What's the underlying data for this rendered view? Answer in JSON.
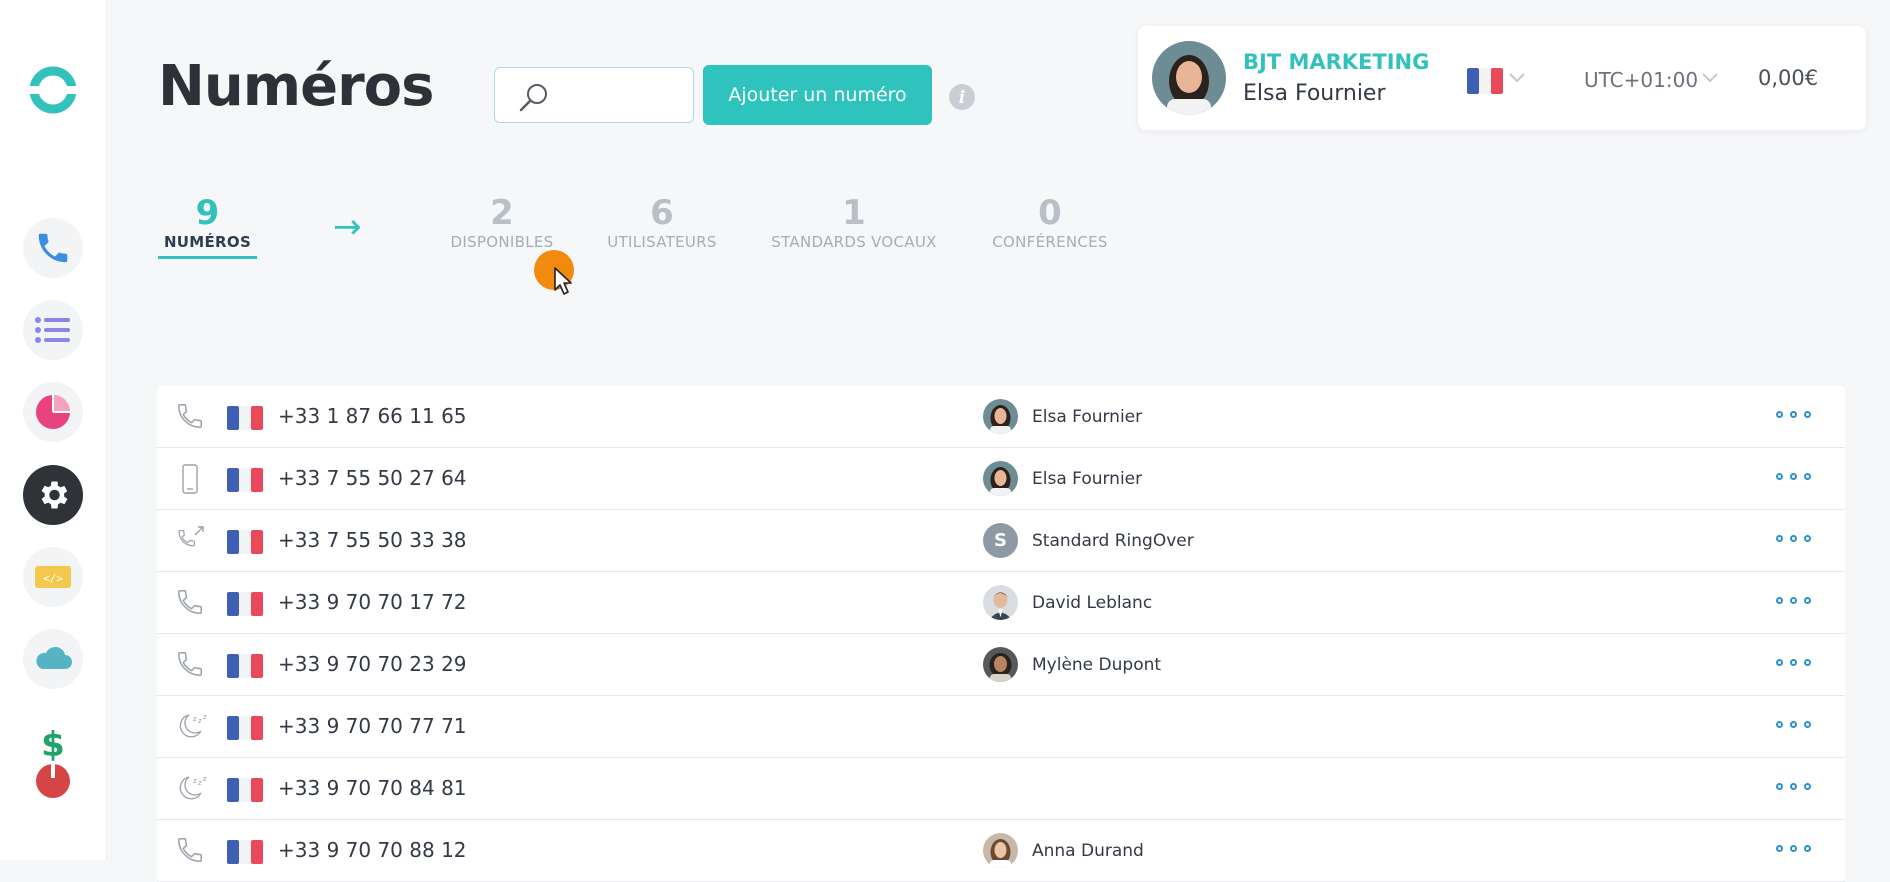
{
  "page": {
    "title": "Numéros"
  },
  "search": {
    "placeholder": ""
  },
  "header": {
    "add_button": "Ajouter un numéro"
  },
  "account": {
    "company": "BJT MARKETING",
    "user": "Elsa Fournier",
    "timezone": "UTC+01:00",
    "credit": "0,00€"
  },
  "stats": [
    {
      "value": "9",
      "label": "NUMÉROS"
    },
    {
      "value": "2",
      "label": "DISPONIBLES"
    },
    {
      "value": "6",
      "label": "UTILISATEURS"
    },
    {
      "value": "1",
      "label": "STANDARDS VOCAUX"
    },
    {
      "value": "0",
      "label": "CONFÉRENCES"
    }
  ],
  "sidebar": {
    "items": [
      "logo",
      "phone-icon",
      "list-icon",
      "pie-chart-icon",
      "gear-icon",
      "code-icon",
      "cloud-icon",
      "dollar-icon",
      "power-icon"
    ]
  },
  "rows": [
    {
      "type": "phone-icon",
      "number": "+33 1 87 66 11 65",
      "owner": "Elsa Fournier"
    },
    {
      "type": "mobile-icon",
      "number": "+33 7 55 50 27 64",
      "owner": "Elsa Fournier"
    },
    {
      "type": "ivr-icon",
      "number": "+33 7 55 50 33 38",
      "owner": "Standard RingOver",
      "initial": "S"
    },
    {
      "type": "phone-icon",
      "number": "+33 9 70 70 17 72",
      "owner": "David Leblanc"
    },
    {
      "type": "phone-icon",
      "number": "+33 9 70 70 23 29",
      "owner": "Mylène Dupont"
    },
    {
      "type": "sleep-icon",
      "number": "+33 9 70 70 77 71",
      "owner": ""
    },
    {
      "type": "sleep-icon",
      "number": "+33 9 70 70 84 81",
      "owner": ""
    },
    {
      "type": "phone-icon",
      "number": "+33 9 70 70 88 12",
      "owner": "Anna Durand"
    }
  ],
  "colors": {
    "accent": "#33c2bb",
    "link": "#2e8fcf",
    "cursor": "#f28a10"
  }
}
